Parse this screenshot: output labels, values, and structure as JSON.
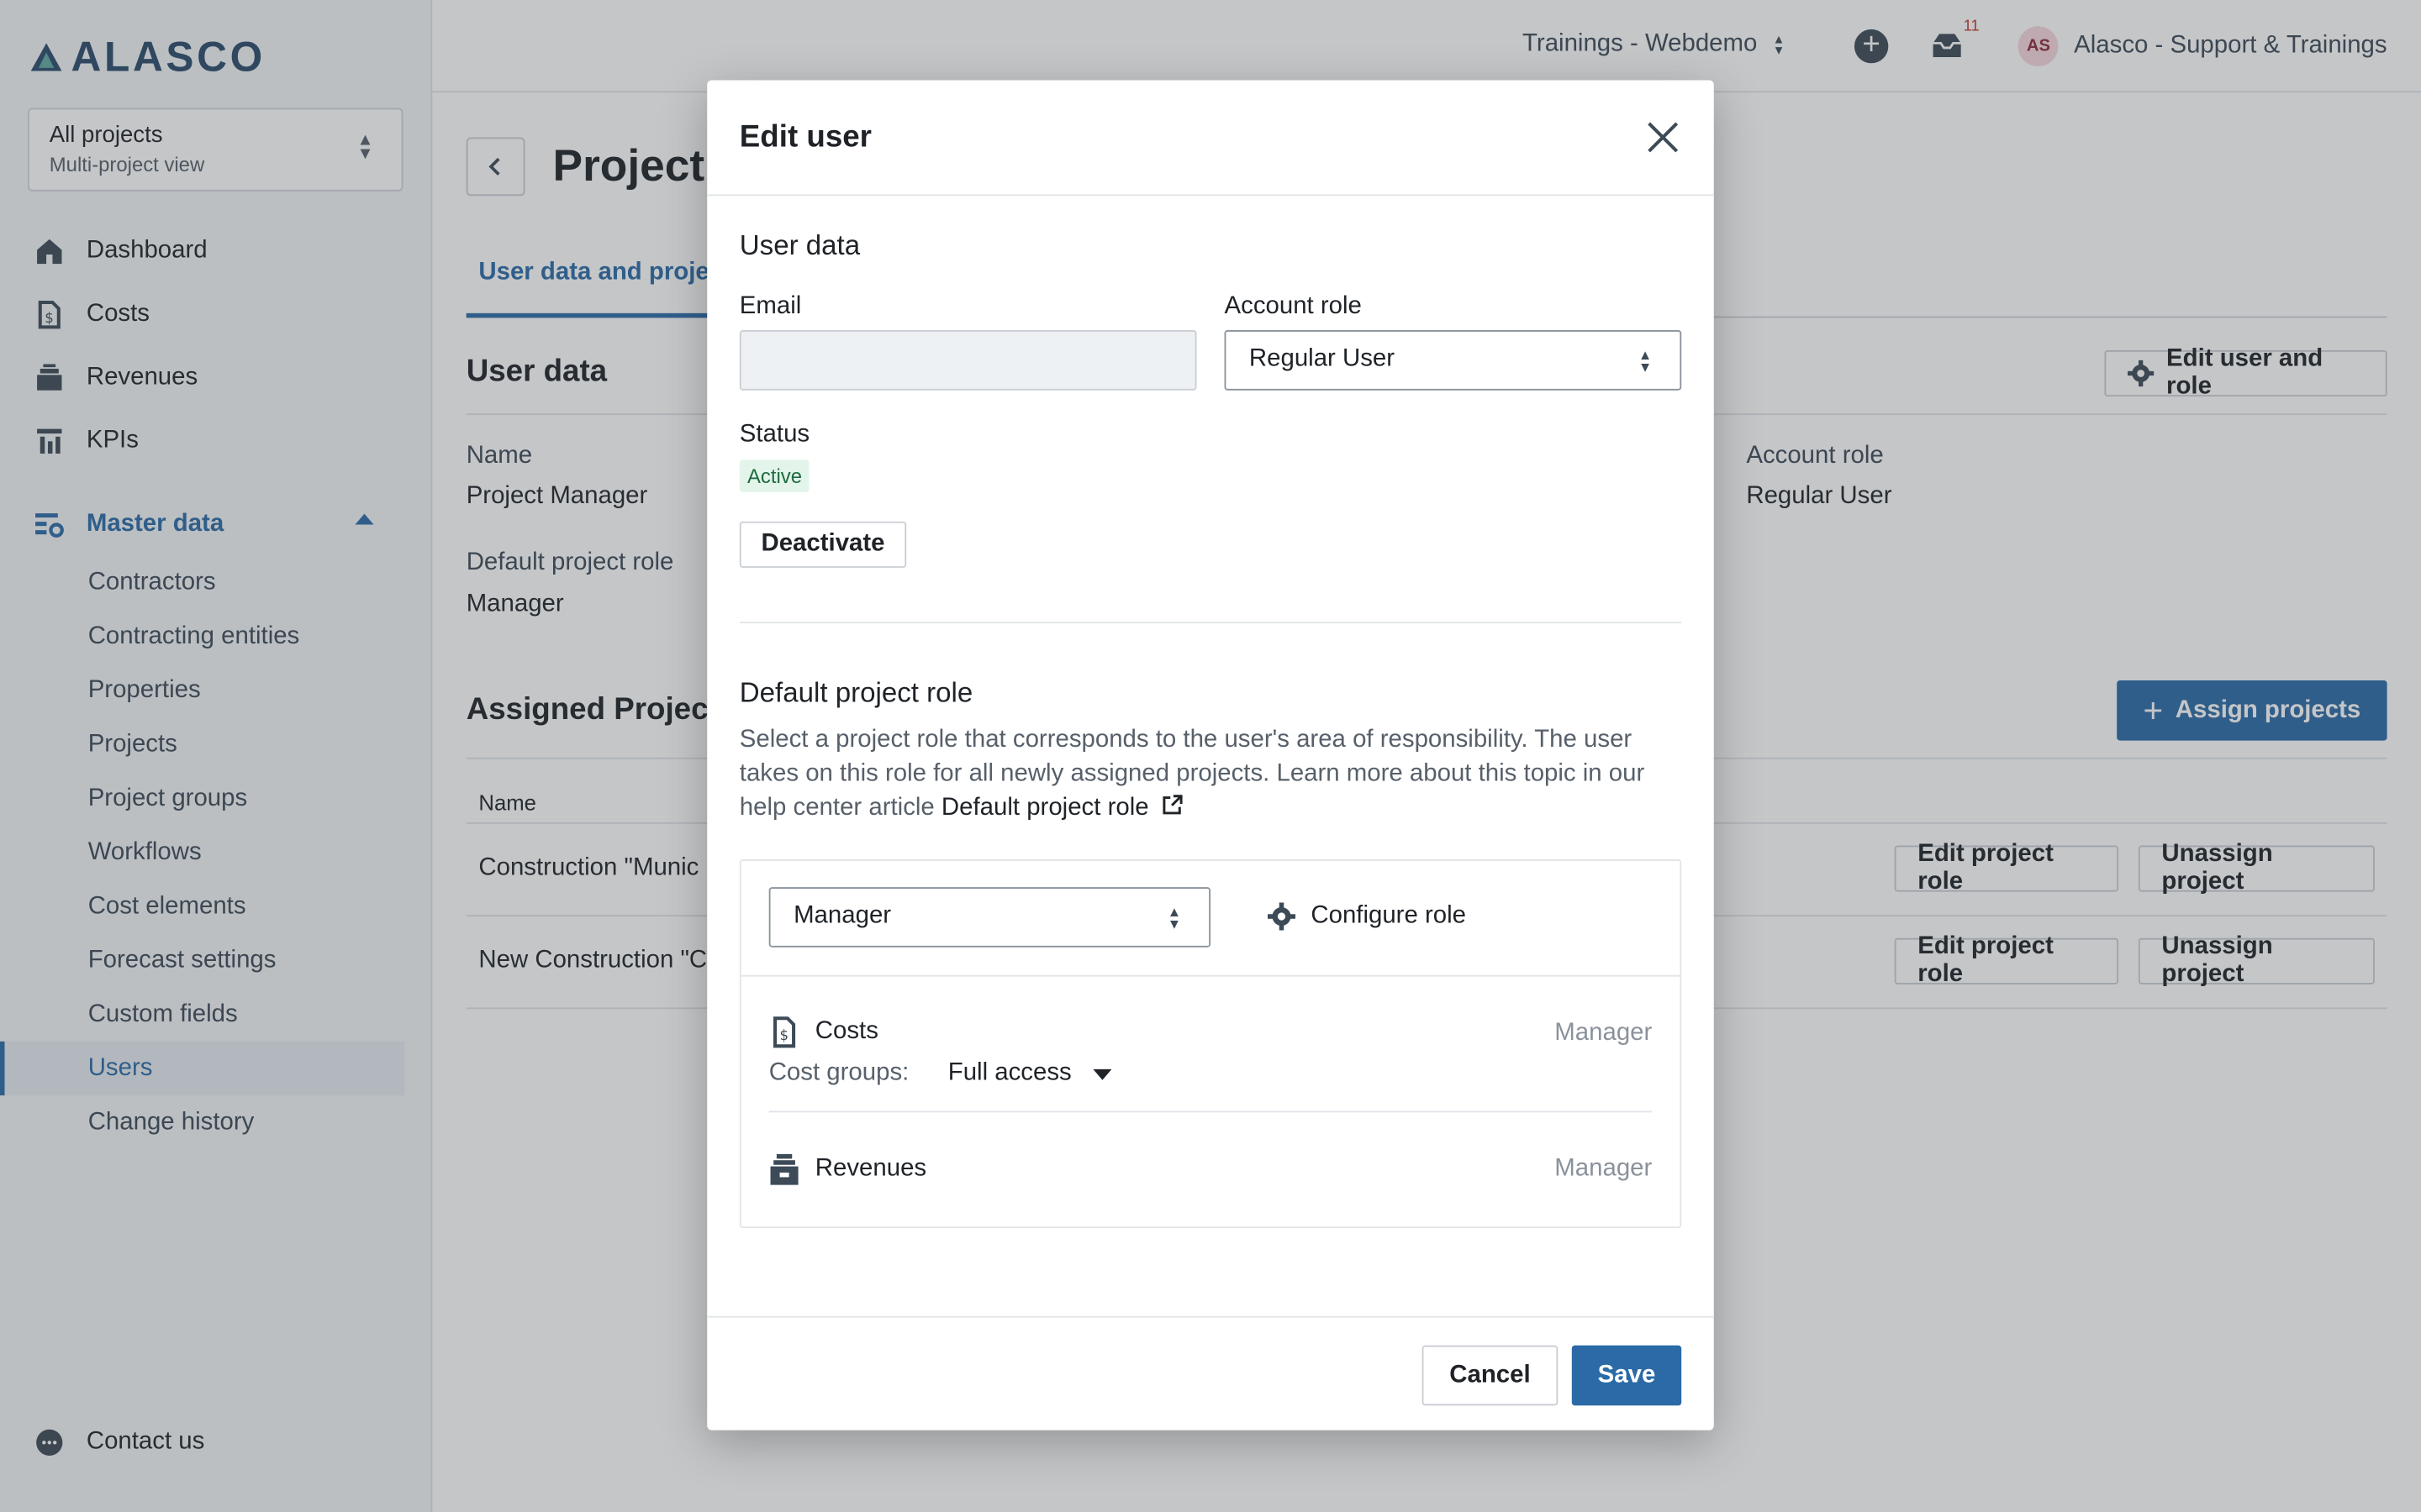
{
  "brand": {
    "name": "ALASCO"
  },
  "project_selector": {
    "title": "All projects",
    "subtitle": "Multi-project view"
  },
  "sidebar": {
    "items": [
      {
        "label": "Dashboard",
        "icon": "home-icon"
      },
      {
        "label": "Costs",
        "icon": "costs-icon"
      },
      {
        "label": "Revenues",
        "icon": "revenues-icon"
      },
      {
        "label": "KPIs",
        "icon": "kpi-icon"
      }
    ],
    "group": {
      "label": "Master data",
      "items": [
        "Contractors",
        "Contracting entities",
        "Properties",
        "Projects",
        "Project groups",
        "Workflows",
        "Cost elements",
        "Forecast settings",
        "Custom fields",
        "Users",
        "Change history"
      ],
      "active_index": 9
    },
    "contact": "Contact us"
  },
  "topbar": {
    "tenant": "Trainings - Webdemo",
    "notifications_count": "11",
    "avatar_initials": "AS",
    "user_name": "Alasco - Support & Trainings"
  },
  "page": {
    "title": "Project I",
    "tab_active": "User data and project",
    "user_data_title": "User data",
    "edit_user_role_button": "Edit user and role",
    "name_label": "Name",
    "name_value": "Project Manager",
    "account_role_label": "Account role",
    "account_role_value": "Regular User",
    "default_role_label": "Default project role",
    "default_role_value": "Manager",
    "assigned_title": "Assigned Project",
    "assign_button": "Assign projects",
    "table_header_name": "Name",
    "rows": [
      {
        "name": "Construction \"Munic",
        "edit": "Edit project role",
        "unassign": "Unassign project"
      },
      {
        "name": "New Construction \"C",
        "edit": "Edit project role",
        "unassign": "Unassign project"
      }
    ]
  },
  "modal": {
    "title": "Edit user",
    "user_data_title": "User data",
    "email_label": "Email",
    "email_value": "",
    "account_role_label": "Account role",
    "account_role_value": "Regular User",
    "status_label": "Status",
    "status_value": "Active",
    "deactivate_button": "Deactivate",
    "default_role_title": "Default project role",
    "default_role_desc": "Select a project role that corresponds to the user's area of responsibility. The user takes on this role for all newly assigned projects. Learn more about this topic in our help center article ",
    "default_role_link": "Default project role",
    "role_select_value": "Manager",
    "configure_role": "Configure role",
    "costs_label": "Costs",
    "costs_role": "Manager",
    "cost_groups_label": "Cost groups:",
    "cost_groups_value": "Full access",
    "revenues_label": "Revenues",
    "revenues_role": "Manager",
    "cancel_button": "Cancel",
    "save_button": "Save"
  },
  "colors": {
    "accent": "#2b6aa6",
    "badge_bg": "#e3f4ea",
    "badge_text": "#1e6b3e",
    "notification": "#c0392b"
  }
}
